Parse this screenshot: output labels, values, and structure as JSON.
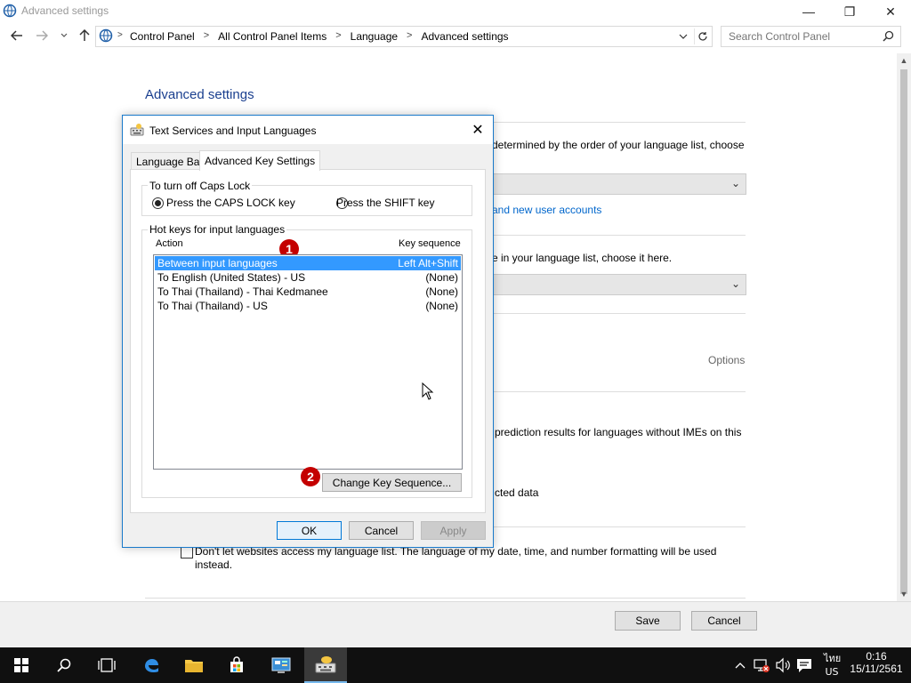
{
  "window": {
    "title": "Advanced settings",
    "controls": {
      "minimize": "—",
      "restore": "❐",
      "close": "✕"
    }
  },
  "address": {
    "crumbs": [
      "Control Panel",
      "All Control Panel Items",
      "Language",
      "Advanced settings"
    ],
    "search_placeholder": "Search Control Panel"
  },
  "page": {
    "title": "Advanced settings",
    "text1": "determined by the order of your language list, choose",
    "link1": "and new user accounts",
    "text2": "e in your language list, choose it here.",
    "options_link": "Options",
    "text3": "prediction results for languages without IMEs on this",
    "text4": "cted data",
    "checkbox_label_line1": "Don't let websites access my language list. The language of my date, time, and number formatting will be used",
    "checkbox_label_line2": "instead.",
    "save": "Save",
    "cancel": "Cancel"
  },
  "dialog": {
    "title": "Text Services and Input Languages",
    "tabs": [
      "Language Bar",
      "Advanced Key Settings"
    ],
    "caps_group": "To turn off Caps Lock",
    "caps_option1": "Press the CAPS LOCK key",
    "caps_option2": "Press the SHIFT key",
    "hotkeys_group": "Hot keys for input languages",
    "col_action": "Action",
    "col_key": "Key sequence",
    "rows": [
      {
        "action": "Between input languages",
        "key": "Left Alt+Shift"
      },
      {
        "action": "To English (United States) - US",
        "key": "(None)"
      },
      {
        "action": "To Thai (Thailand) - Thai Kedmanee",
        "key": "(None)"
      },
      {
        "action": "To Thai (Thailand) - US",
        "key": "(None)"
      }
    ],
    "change_key": "Change Key Sequence...",
    "ok": "OK",
    "cancel": "Cancel",
    "apply": "Apply",
    "badge1": "1",
    "badge2": "2"
  },
  "taskbar": {
    "lang_top": "ไทย",
    "lang_bottom": "US",
    "time": "0:16",
    "date": "15/11/2561"
  },
  "colors": {
    "accent": "#1979ca",
    "selection": "#3399ff",
    "badge": "#c40000",
    "taskbar": "#101010"
  }
}
